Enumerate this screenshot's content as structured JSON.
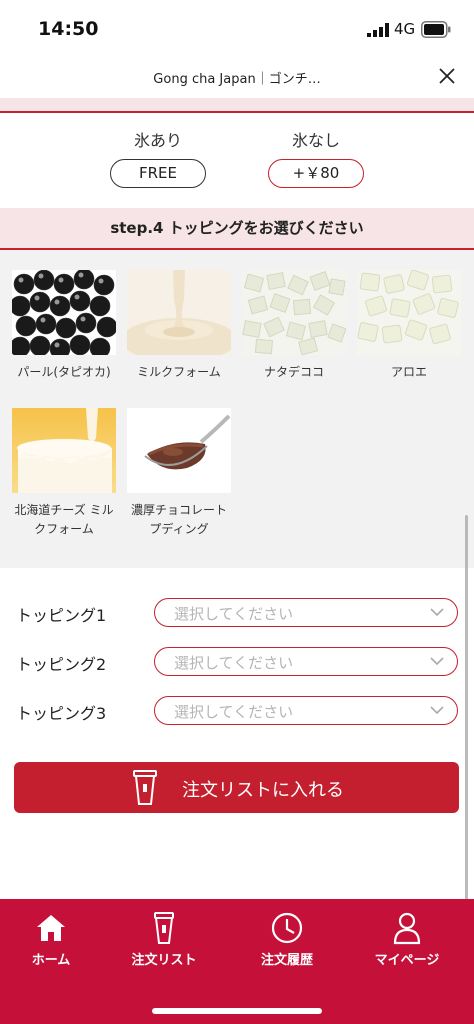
{
  "status_bar": {
    "time": "14:50",
    "network": "4G"
  },
  "header": {
    "title": "Gong cha Japan｜ゴンチ…"
  },
  "ice": {
    "options": [
      {
        "label": "氷あり",
        "price": "FREE"
      },
      {
        "label": "氷なし",
        "price": "+￥80"
      }
    ]
  },
  "step4": {
    "title": "step.4  トッピングをお選びください"
  },
  "toppings": [
    {
      "name": "パール(タピオカ)",
      "icon": "tapioca-pearls"
    },
    {
      "name": "ミルクフォーム",
      "icon": "milk-foam"
    },
    {
      "name": "ナタデココ",
      "icon": "nata-de-coco"
    },
    {
      "name": "アロエ",
      "icon": "aloe"
    },
    {
      "name": "北海道チーズ ミルクフォーム",
      "icon": "cheese-milk-foam"
    },
    {
      "name": "濃厚チョコレートプディング",
      "icon": "chocolate-pudding"
    }
  ],
  "selects": [
    {
      "label": "トッピング1",
      "placeholder": "選択してください"
    },
    {
      "label": "トッピング2",
      "placeholder": "選択してください"
    },
    {
      "label": "トッピング3",
      "placeholder": "選択してください"
    }
  ],
  "add_button": {
    "label": "注文リストに入れる",
    "icon": "cup-icon"
  },
  "nav": {
    "items": [
      {
        "label": "ホーム",
        "icon": "home-icon"
      },
      {
        "label": "注文リスト",
        "icon": "cup-icon"
      },
      {
        "label": "注文履歴",
        "icon": "clock-icon"
      },
      {
        "label": "マイページ",
        "icon": "user-icon"
      }
    ]
  },
  "colors": {
    "brand_red": "#c41f2f",
    "nav_red": "#c5103a",
    "band_pink": "#f7e4e6",
    "grid_bg": "#f2f2f2"
  }
}
